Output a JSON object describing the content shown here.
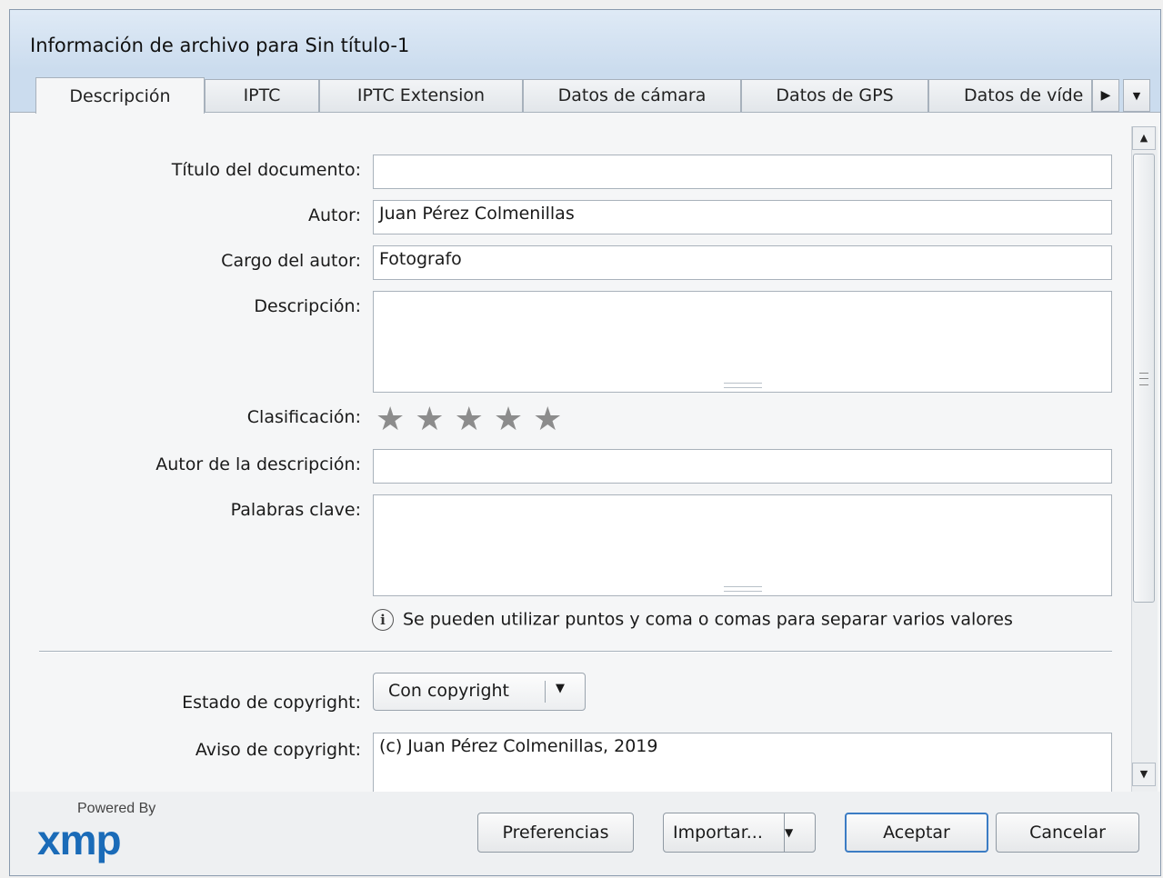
{
  "window": {
    "title": "Información de archivo para Sin título-1"
  },
  "tabs": [
    {
      "label": "Descripción"
    },
    {
      "label": "IPTC"
    },
    {
      "label": "IPTC Extension"
    },
    {
      "label": "Datos de cámara"
    },
    {
      "label": "Datos de GPS"
    },
    {
      "label": "Datos de víde"
    }
  ],
  "tab_controls": {
    "next_icon": "triangle-right-icon",
    "menu_icon": "triangle-down-icon"
  },
  "fields": {
    "titulo": {
      "label": "Título del documento:",
      "value": ""
    },
    "autor": {
      "label": "Autor:",
      "value": "Juan Pérez Colmenillas"
    },
    "cargo": {
      "label": "Cargo del autor:",
      "value": "Fotografo"
    },
    "descripcion": {
      "label": "Descripción:",
      "value": ""
    },
    "clasificacion": {
      "label": "Clasificación:",
      "rating": 0,
      "max": 5
    },
    "autor_descripcion": {
      "label": "Autor de la descripción:",
      "value": ""
    },
    "palabras_clave": {
      "label": "Palabras clave:",
      "value": ""
    },
    "hint": "Se pueden utilizar puntos y coma o comas para separar varios valores",
    "estado_copyright": {
      "label": "Estado de copyright:",
      "value": "Con copyright"
    },
    "aviso_copyright": {
      "label": "Aviso de copyright:",
      "value": "(c) Juan Pérez Colmenillas, 2019"
    }
  },
  "footer": {
    "powered_by": "Powered By",
    "logo": "xmp",
    "preferencias": "Preferencias",
    "importar": "Importar...",
    "aceptar": "Aceptar",
    "cancelar": "Cancelar"
  }
}
